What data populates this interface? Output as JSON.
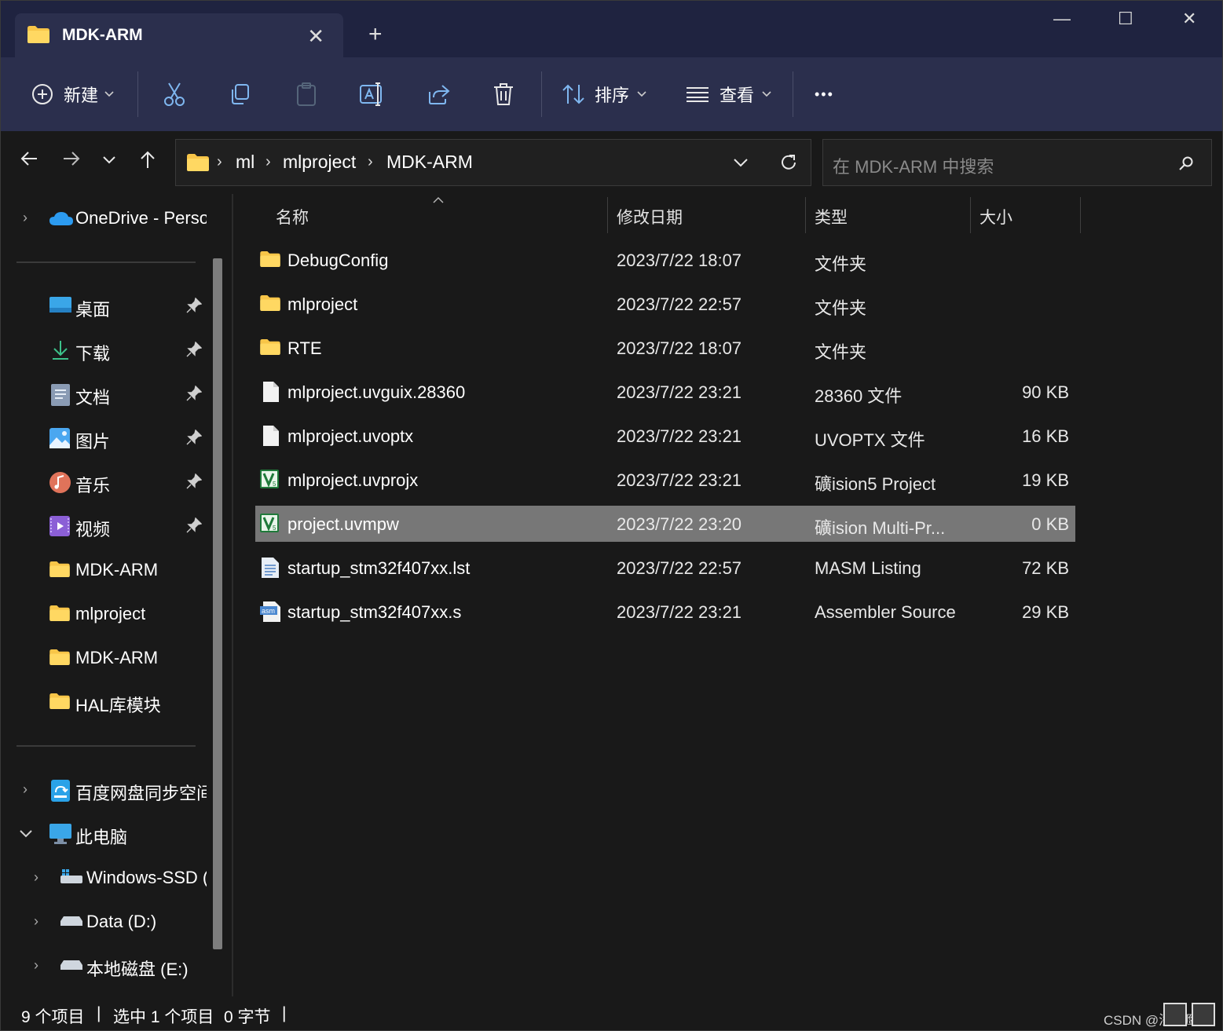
{
  "window": {
    "tab_title": "MDK-ARM",
    "new_tab": "+",
    "minimize": "—",
    "maximize": "☐",
    "close": "✕"
  },
  "toolbar": {
    "new_label": "新建",
    "sort_label": "排序",
    "view_label": "查看",
    "more_label": "•••"
  },
  "address": {
    "crumbs": [
      "ml",
      "mlproject",
      "MDK-ARM"
    ],
    "separator": "›",
    "search_placeholder": "在 MDK-ARM 中搜索"
  },
  "sidebar": {
    "onedrive": "OneDrive - Perso",
    "quick": [
      "桌面",
      "下载",
      "文档",
      "图片",
      "音乐",
      "视频",
      "MDK-ARM",
      "mlproject",
      "MDK-ARM",
      "HAL库模块"
    ],
    "baidu": "百度网盘同步空间",
    "thispc": "此电脑",
    "drives": [
      "Windows-SSD (C:)",
      "Data (D:)",
      "本地磁盘 (E:)"
    ]
  },
  "columns": {
    "name": "名称",
    "date": "修改日期",
    "type": "类型",
    "size": "大小"
  },
  "files": [
    {
      "name": "DebugConfig",
      "date": "2023/7/22 18:07",
      "type": "文件夹",
      "size": "",
      "icon": "folder-icon"
    },
    {
      "name": "mlproject",
      "date": "2023/7/22 22:57",
      "type": "文件夹",
      "size": "",
      "icon": "folder-icon"
    },
    {
      "name": "RTE",
      "date": "2023/7/22 18:07",
      "type": "文件夹",
      "size": "",
      "icon": "folder-icon"
    },
    {
      "name": "mlproject.uvguix.28360",
      "date": "2023/7/22 23:21",
      "type": "28360 文件",
      "size": "90 KB",
      "icon": "file-icon"
    },
    {
      "name": "mlproject.uvoptx",
      "date": "2023/7/22 23:21",
      "type": "UVOPTX 文件",
      "size": "16 KB",
      "icon": "file-icon"
    },
    {
      "name": "mlproject.uvprojx",
      "date": "2023/7/22 23:21",
      "type": "礦ision5 Project",
      "size": "19 KB",
      "icon": "keil-icon"
    },
    {
      "name": "project.uvmpw",
      "date": "2023/7/22 23:20",
      "type": "礦ision Multi-Pr...",
      "size": "0 KB",
      "icon": "keil-icon"
    },
    {
      "name": "startup_stm32f407xx.lst",
      "date": "2023/7/22 22:57",
      "type": "MASM Listing",
      "size": "72 KB",
      "icon": "text-file-icon"
    },
    {
      "name": "startup_stm32f407xx.s",
      "date": "2023/7/22 23:21",
      "type": "Assembler Source",
      "size": "29 KB",
      "icon": "asm-file-icon"
    }
  ],
  "status": {
    "count": "9 个项目",
    "selected": "选中 1 个项目",
    "bytes": "0 字节",
    "watermark": "CSDN @浅醒鹰心"
  }
}
